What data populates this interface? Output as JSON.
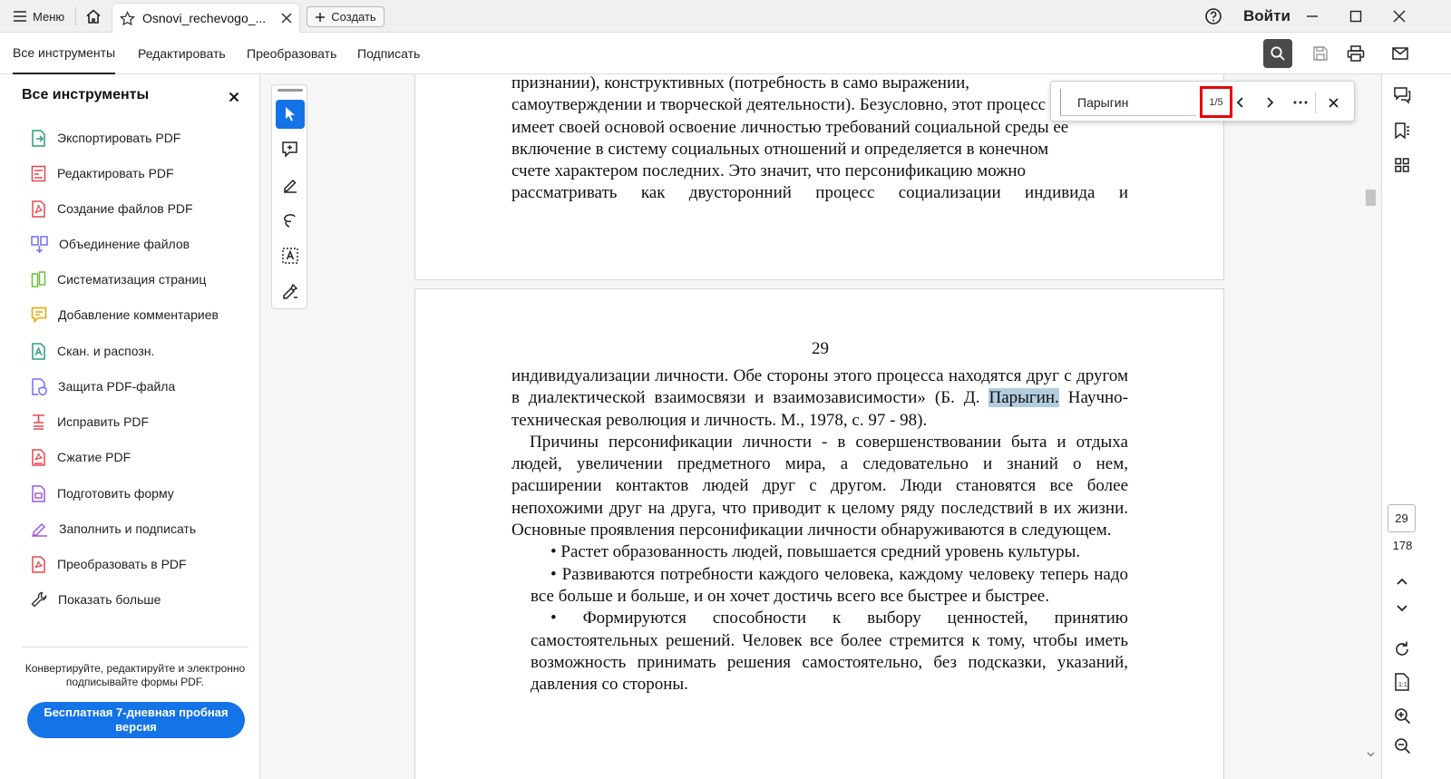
{
  "titlebar": {
    "menu_label": "Меню",
    "tab_title": "Osnovi_rechevogo_...",
    "create_label": "Создать",
    "login_label": "Войти"
  },
  "toolbar": {
    "tabs": [
      "Все инструменты",
      "Редактировать",
      "Преобразовать",
      "Подписать"
    ]
  },
  "left_panel": {
    "title": "Все инструменты",
    "items": [
      {
        "label": "Экспортировать PDF",
        "color": "#2d9d78"
      },
      {
        "label": "Редактировать PDF",
        "color": "#e34850"
      },
      {
        "label": "Создание файлов PDF",
        "color": "#e34850"
      },
      {
        "label": "Объединение файлов",
        "color": "#6e6ef5"
      },
      {
        "label": "Систематизация страниц",
        "color": "#6bbf3a"
      },
      {
        "label": "Добавление комментариев",
        "color": "#e0a800"
      },
      {
        "label": "Скан. и распозн.",
        "color": "#2d9d78"
      },
      {
        "label": "Защита PDF-файла",
        "color": "#6e6ef5"
      },
      {
        "label": "Исправить PDF",
        "color": "#e34850"
      },
      {
        "label": "Сжатие PDF",
        "color": "#e34850"
      },
      {
        "label": "Подготовить форму",
        "color": "#9b59d0"
      },
      {
        "label": "Заполнить и подписать",
        "color": "#9b59d0"
      },
      {
        "label": "Преобразовать в PDF",
        "color": "#e34850"
      },
      {
        "label": "Показать больше",
        "color": "#333333"
      }
    ],
    "promo_text": "Конвертируйте, редактируйте и электронно подписывайте формы PDF.",
    "trial_label": "Бесплатная 7-дневная пробная версия"
  },
  "find": {
    "query": "Парыгин",
    "count": "1/5"
  },
  "page1": {
    "lines": [
      "признании),   конструктивных   (потребность   в   само   выражении,",
      "самоутверждении и творческой деятельности). Безусловно, этот процесс",
      "имеет своей основой освоение личностью требований социальной среды ее",
      "включение в систему социальных отношений и  определяется в конечном",
      "счете характером последних. Это значит, что персонификацию можно",
      "рассматривать как двусторонний  процесс социализации индивида и"
    ]
  },
  "page2": {
    "page_number": "29",
    "p1_a": "индивидуализации личности. Обе стороны этого процесса находятся друг с другом в диалектической взаимосвязи и взаимозависимости» (Б. Д. ",
    "p1_highlight": "Парыгин.",
    "p1_b": " Научно-техническая революция и личность. М., 1978, с. 97 - 98).",
    "p2": "Причины персонификации личности - в совершенствовании быта  и отдыха людей, увеличении предметного мира, а следовательно и знаний о нем, расширении контактов людей друг с другом. Люди становятся все более непохожими друг на друга, что приводит  к целому ряду последствий  в их жизни. Основные проявления персонификации личности обнаруживаются в следующем.",
    "bullets": [
      "Растет образованность  людей, повышается средний уровень культуры.",
      "Развиваются потребности каждого человека, каждому человеку теперь надо все больше и больше,  и он хочет достичь всего все быстрее и быстрее.",
      "Формируются способности к выбору ценностей,  принятию самостоятельных решений. Человек все более стремится к тому, чтобы иметь возможность принимать решения самостоятельно, без подсказки, указаний, давления со стороны."
    ]
  },
  "right_rail": {
    "current_page": "29",
    "total_pages": "178"
  },
  "colors": {
    "accent": "#1473e6",
    "find_highlight": "#e8000b",
    "search_highlight": "#b3cde0"
  }
}
